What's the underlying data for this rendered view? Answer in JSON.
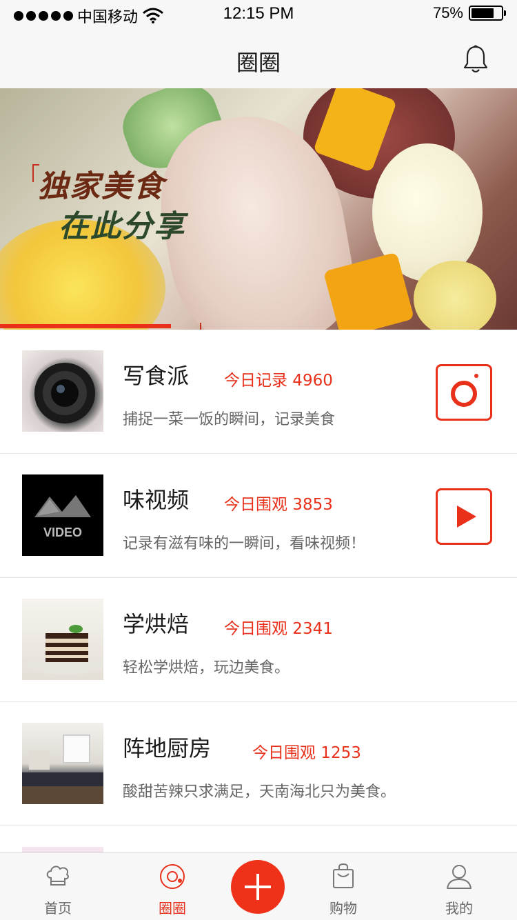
{
  "status_bar": {
    "carrier": "中国移动",
    "time": "12:15 PM",
    "battery_percent": "75%",
    "battery_level": 0.75
  },
  "nav": {
    "title": "圈圈",
    "bell_icon": "bell-icon"
  },
  "banner": {
    "line1": "独家美食",
    "line2": "在此分享",
    "progress": 0.33
  },
  "colors": {
    "accent": "#e8301a",
    "text_primary": "#1a1a1a",
    "text_secondary": "#666666",
    "background": "#ffffff",
    "bar_background": "#f7f7f7"
  },
  "items": [
    {
      "title": "写食派",
      "stat": "今日记录 4960",
      "desc": "捕捉一菜一饭的瞬间，记录美食",
      "thumb": "camera-lens-photo",
      "action_icon": "camera-icon"
    },
    {
      "title": "味视频",
      "stat": "今日围观 3853",
      "desc": "记录有滋有味的一瞬间，看味视频！",
      "thumb": "video-clapper-photo",
      "thumb_label": "VIDEO",
      "action_icon": "play-icon"
    },
    {
      "title": "学烘焙",
      "stat": "今日围观 2341",
      "desc": "轻松学烘焙，玩边美食。",
      "thumb": "cake-photo"
    },
    {
      "title": "阵地厨房",
      "stat": "今日围观 1253",
      "desc": "酸甜苦辣只求满足，天南海北只为美食。",
      "thumb": "kitchen-photo"
    }
  ],
  "tabs": [
    {
      "label": "首页",
      "icon": "chef-hat-icon",
      "active": false
    },
    {
      "label": "圈圈",
      "icon": "circle-icon",
      "active": true
    },
    {
      "label": "",
      "icon": "plus-icon",
      "active": false
    },
    {
      "label": "购物",
      "icon": "shopping-bag-icon",
      "active": false
    },
    {
      "label": "我的",
      "icon": "user-icon",
      "active": false
    }
  ]
}
